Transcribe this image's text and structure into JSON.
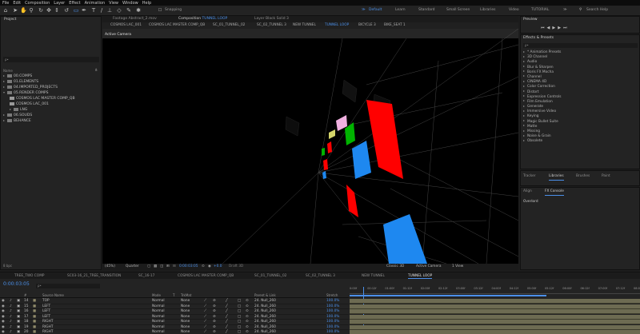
{
  "menu": [
    "File",
    "Edit",
    "Composition",
    "Layer",
    "Effect",
    "Animation",
    "View",
    "Window",
    "Help"
  ],
  "toolbar": {
    "snapping_label": "Snapping"
  },
  "workspaces": [
    "Default",
    "Learn",
    "Standard",
    "Small Screen",
    "Libraries",
    "Video",
    "TUTORIAL"
  ],
  "search_help": "Search Help",
  "project": {
    "title": "Project",
    "search_placeholder": "ρ•",
    "name_header": "Name",
    "items": [
      "00.COMPS",
      "01.ELEMENTS",
      "04.IMPORTED_PROJECTS",
      "05.RENDER COMPS",
      "COSMOS LAC MASTER COMP_QB",
      "COSMOS LAC_001",
      "LNG",
      "06.SOUDS",
      "BEHANCE"
    ],
    "bpc": "8 bpc"
  },
  "viewer": {
    "tab_footage": "Footage Abstract_2.mov",
    "tab_composition": "Composition",
    "tab_composition_name": "TUNNEL LOOP",
    "tab_layer": "Layer Black Solid 3",
    "subtabs": [
      "COSMOS LAC_001",
      "COSMOS LAC MASTER COMP_QB",
      "SC_01_TUNNEL_02",
      "SC_02_TUNNEL 3",
      "NEW TUNNEL",
      "TUNNEL LOOP",
      "BICYCLE 3",
      "BIKE_SEAT 1"
    ],
    "active_subtab": "TUNNEL LOOP",
    "active_camera": "Active Camera",
    "zoom": "(45%)",
    "resolution": "Quarter",
    "timecode": "0:00:03:05",
    "offset": "+0.0",
    "draft3d": "Draft 3D",
    "renderer": "Classic 3D",
    "camera": "Active Camera",
    "views": "1 View"
  },
  "preview": {
    "title": "Preview"
  },
  "effects": {
    "title": "Effects & Presets",
    "search_placeholder": "ρ•",
    "items": [
      "* Animation Presets",
      "3D Channel",
      "Audio",
      "Blur & Sharpen",
      "Boris FX Mocha",
      "Channel",
      "CINEMA 4D",
      "Color Correction",
      "Distort",
      "Expression Controls",
      "Film Emulation",
      "Generate",
      "Immersive Video",
      "Keying",
      "Magic Bullet Suite",
      "Matte",
      "Missing",
      "Noise & Grain",
      "Obsolete"
    ]
  },
  "libraries": {
    "tabs": [
      "Tracker",
      "Libraries",
      "Brushes",
      "Paint"
    ],
    "active": "Libraries"
  },
  "align": {
    "tabs": [
      "Align",
      "FX Console"
    ],
    "active": "FX Console"
  },
  "overlord": "Overlord",
  "timeline": {
    "tabs": [
      "TREE_TWO COMP",
      "SC03-16_21_TREE_TRANSITION",
      "SC_16-17",
      "COSMOS LAC MASTER COMP_QB",
      "SC_01_TUNNEL_02",
      "SC_02_TUNNEL 3",
      "NEW TUNNEL",
      "TUNNEL LOOP"
    ],
    "active_tab": "TUNNEL LOOP",
    "timecode": "0:00:03:05",
    "search_placeholder": "ρ•",
    "headers": {
      "num": "#",
      "name": "Source Name",
      "mode": "Mode",
      "t": "T",
      "trkmat": "TrkMat",
      "parent": "Parent & Link",
      "stretch": "Stretch"
    },
    "rows": [
      {
        "num": "14",
        "name": "TOP",
        "mode": "Normal",
        "trkmat": "None",
        "parent": "24. Null_260",
        "stretch": "100.0%"
      },
      {
        "num": "15",
        "name": "LEFT",
        "mode": "Normal",
        "trkmat": "None",
        "parent": "24. Null_260",
        "stretch": "100.0%"
      },
      {
        "num": "16",
        "name": "LEFT",
        "mode": "Normal",
        "trkmat": "None",
        "parent": "24. Null_260",
        "stretch": "100.0%"
      },
      {
        "num": "17",
        "name": "LEFT",
        "mode": "Normal",
        "trkmat": "None",
        "parent": "24. Null_260",
        "stretch": "100.0%"
      },
      {
        "num": "18",
        "name": "RIGHT",
        "mode": "Normal",
        "trkmat": "None",
        "parent": "24. Null_260",
        "stretch": "100.0%"
      },
      {
        "num": "19",
        "name": "RIGHT",
        "mode": "Normal",
        "trkmat": "None",
        "parent": "24. Null_260",
        "stretch": "100.0%"
      },
      {
        "num": "20",
        "name": "RIGHT",
        "mode": "Normal",
        "trkmat": "None",
        "parent": "24. Null_260",
        "stretch": "100.0%"
      }
    ],
    "ruler": [
      "0:00f",
      "00:12f",
      "01:00f",
      "01:12f",
      "02:00f",
      "02:12f",
      "03:00f",
      "03:12f",
      "04:00f",
      "04:12f",
      "05:00f",
      "05:12f",
      "06:00f",
      "06:12f",
      "07:00f",
      "07:12f",
      "08:00f"
    ]
  },
  "colors": {
    "accent": "#4b8fe8",
    "track": "#6d6b52",
    "red": "#ff0000",
    "blue": "#1e88f0",
    "green": "#00b300",
    "pink": "#f0b0e0"
  }
}
